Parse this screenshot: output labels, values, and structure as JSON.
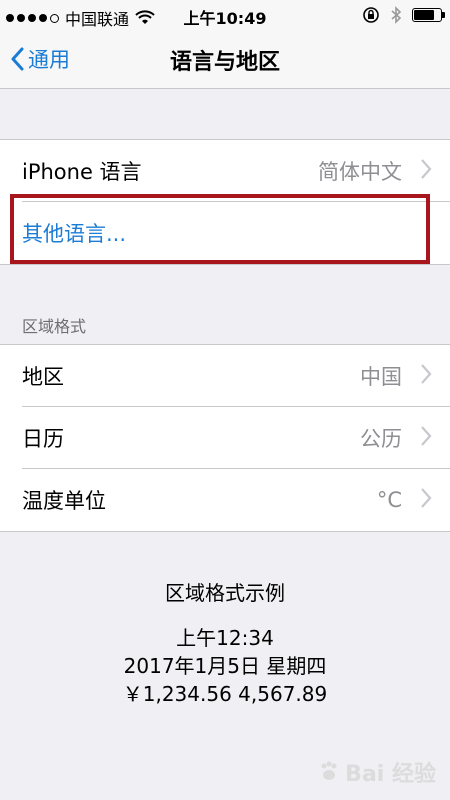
{
  "status_bar": {
    "carrier": "中国联通",
    "time": "上午10:49"
  },
  "nav": {
    "back_label": "通用",
    "title": "语言与地区"
  },
  "language_group": [
    {
      "label": "iPhone 语言",
      "value": "简体中文"
    },
    {
      "label": "其他语言..."
    }
  ],
  "region_section_header": "区域格式",
  "region_group": [
    {
      "label": "地区",
      "value": "中国"
    },
    {
      "label": "日历",
      "value": "公历"
    },
    {
      "label": "温度单位",
      "value": "°C"
    }
  ],
  "example": {
    "title": "区域格式示例",
    "time": "上午12:34",
    "date": "2017年1月5日 星期四",
    "numbers": "￥1,234.56   4,567.89"
  },
  "watermark": "Bai 经验",
  "colors": {
    "accent": "#1b7cd6",
    "highlight_border": "#a8151d",
    "background": "#efeff4"
  },
  "status_icons": [
    "wifi-icon",
    "orientation-lock-icon",
    "bluetooth-icon",
    "battery-icon"
  ],
  "battery_level_fraction": 0.85
}
